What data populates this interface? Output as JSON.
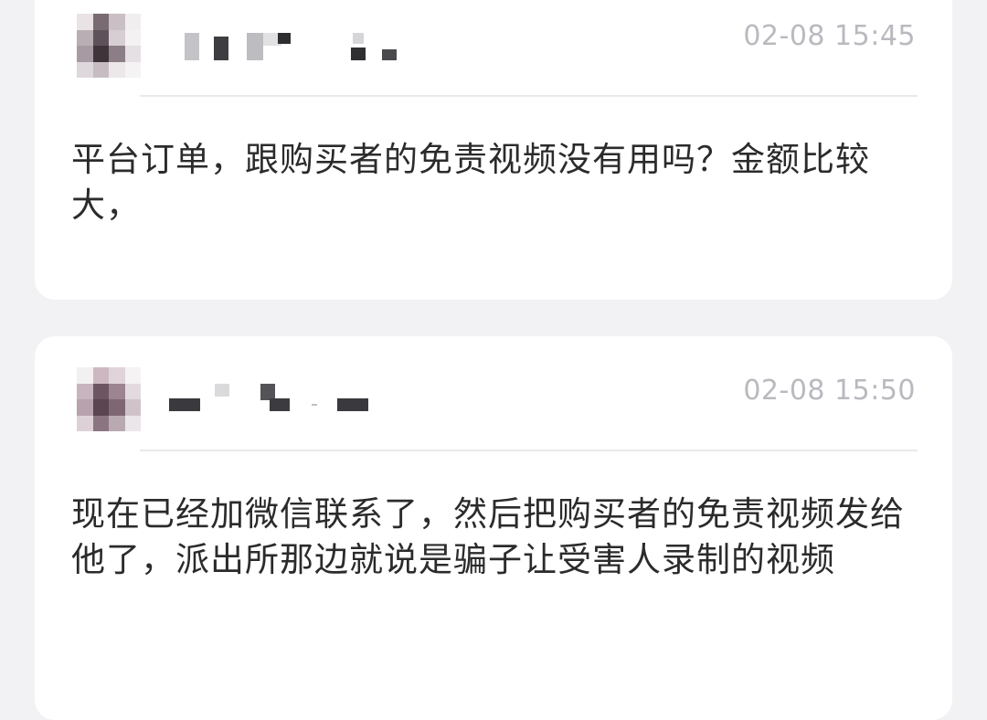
{
  "messages": [
    {
      "timestamp": "02-08 15:45",
      "text": "平台订单，跟购买者的免责视频没有用吗？金额比较大，"
    },
    {
      "timestamp": "02-08 15:50",
      "text": "现在已经加微信联系了，然后把购买者的免责视频发给他了，派出所那边就说是骗子让受害人录制的视频"
    }
  ]
}
